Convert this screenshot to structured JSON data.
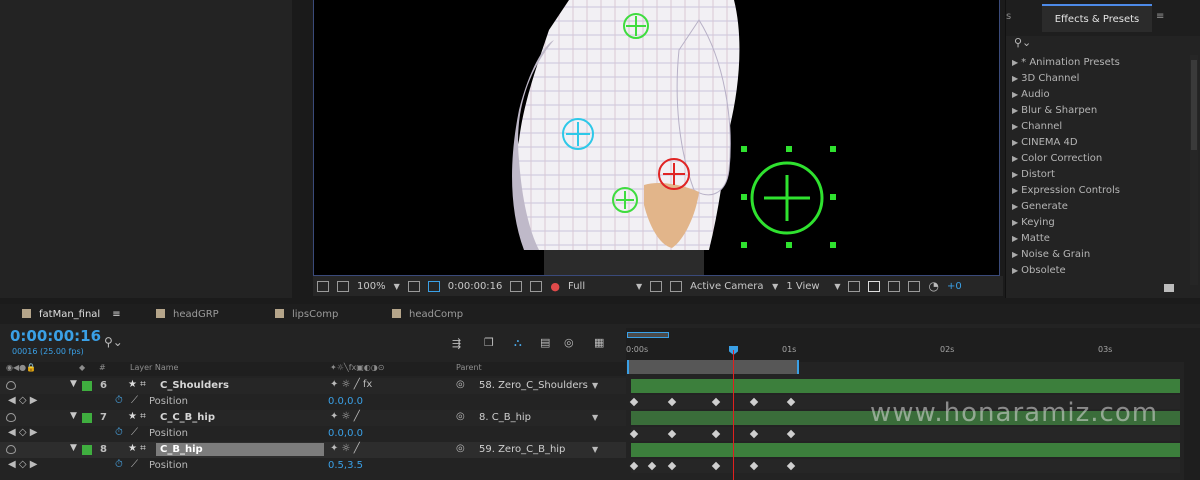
{
  "effects_panel": {
    "tab_prev": "s",
    "tab_label": "Effects & Presets",
    "menu_icon": "hamburger-icon",
    "search_icon": "search-icon",
    "items": [
      "* Animation Presets",
      "3D Channel",
      "Audio",
      "Blur & Sharpen",
      "Channel",
      "CINEMA 4D",
      "Color Correction",
      "Distort",
      "Expression Controls",
      "Generate",
      "Keying",
      "Matte",
      "Noise & Grain",
      "Obsolete"
    ]
  },
  "viewer_toolbar": {
    "zoom": "100%",
    "timecode": "0:00:00:16",
    "resolution": "Full",
    "camera": "Active Camera",
    "views": "1 View",
    "exposure": "+0"
  },
  "timeline": {
    "tabs": [
      "fatMan_final",
      "headGRP",
      "lipsComp",
      "headComp"
    ],
    "active_tab_menu": "≡",
    "timecode": "0:00:00:16",
    "frames": "00016 (25.00 fps)",
    "ruler_labels": [
      "0:00s",
      "01s",
      "02s",
      "03s"
    ],
    "header": {
      "hash": "#",
      "layer_name": "Layer Name",
      "parent": "Parent"
    },
    "rows": [
      {
        "kind": "layer",
        "index": "6",
        "name": "C_Shoulders",
        "parent": "58. Zero_C_Shoulders"
      },
      {
        "kind": "prop",
        "name": "Position",
        "value": "0.0,0.0"
      },
      {
        "kind": "layer",
        "index": "7",
        "name": "C_C_B_hip",
        "parent": "8. C_B_hip"
      },
      {
        "kind": "prop",
        "name": "Position",
        "value": "0.0,0.0"
      },
      {
        "kind": "layer",
        "index": "8",
        "name": "C_B_hip",
        "parent": "59. Zero_C_B_hip"
      },
      {
        "kind": "prop",
        "name": "Position",
        "value": "0.5,3.5"
      }
    ]
  },
  "watermark": "www.honaramiz.com",
  "colors": {
    "accent_blue": "#3aa0e6",
    "label_green": "#3fae3f",
    "playhead_red": "#e02020"
  }
}
